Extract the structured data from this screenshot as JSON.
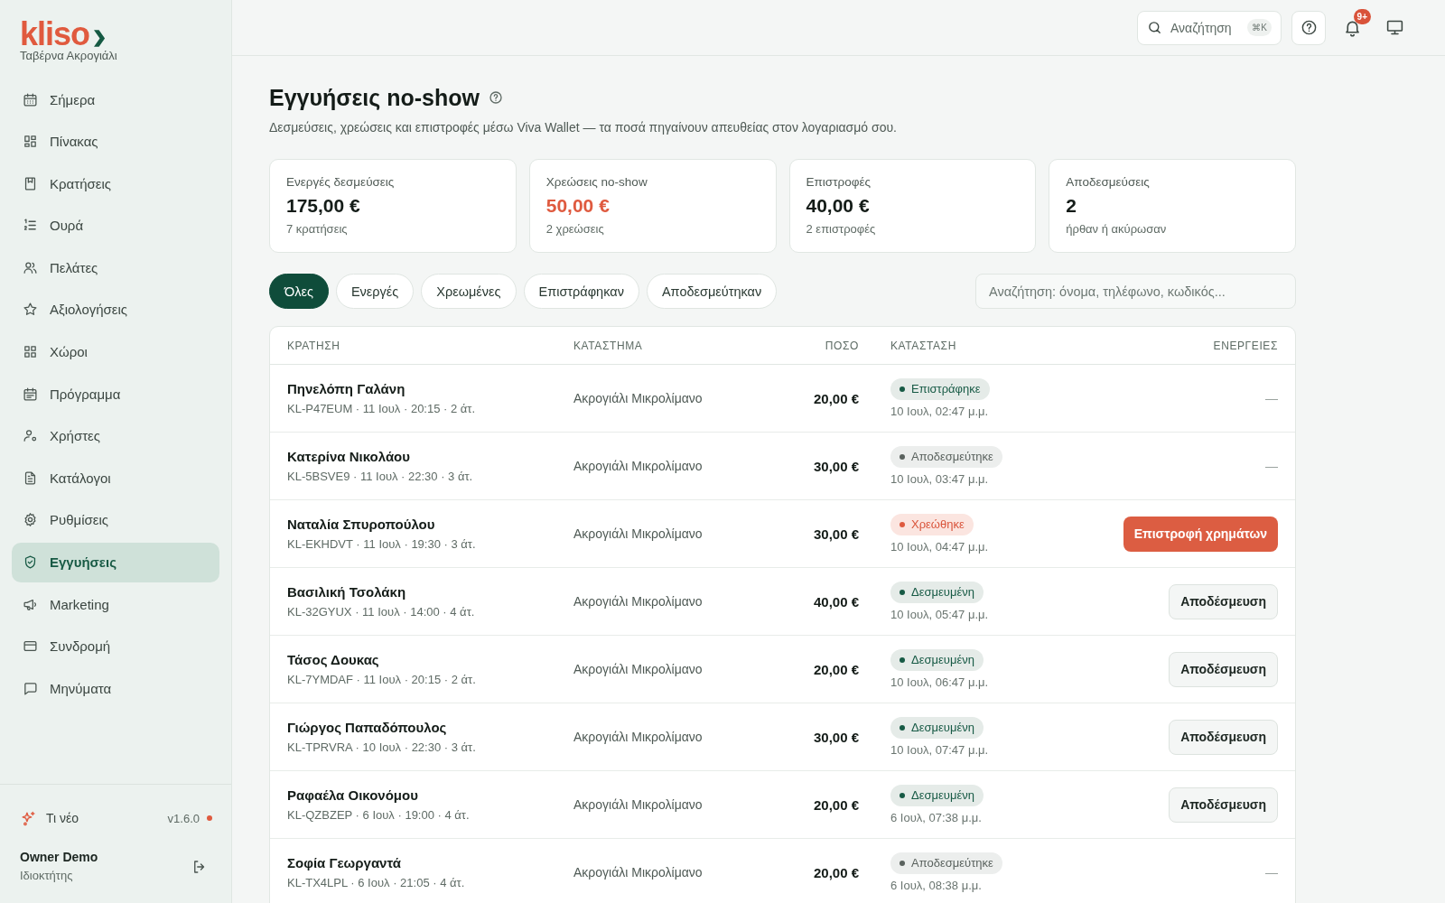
{
  "sidebar": {
    "brand": {
      "logo": "kliso",
      "venue": "Ταβέρνα Ακρογιάλι"
    },
    "items": [
      {
        "label": "Σήμερα",
        "selected": false
      },
      {
        "label": "Πίνακας",
        "selected": false
      },
      {
        "label": "Κρατήσεις",
        "selected": false
      },
      {
        "label": "Ουρά",
        "selected": false
      },
      {
        "label": "Πελάτες",
        "selected": false
      },
      {
        "label": "Αξιολογήσεις",
        "selected": false
      },
      {
        "label": "Χώροι",
        "selected": false
      },
      {
        "label": "Πρόγραμμα",
        "selected": false
      },
      {
        "label": "Χρήστες",
        "selected": false
      },
      {
        "label": "Κατάλογοι",
        "selected": false
      },
      {
        "label": "Ρυθμίσεις",
        "selected": false
      },
      {
        "label": "Εγγυήσεις",
        "selected": true
      },
      {
        "label": "Marketing",
        "selected": false
      },
      {
        "label": "Συνδρομή",
        "selected": false
      },
      {
        "label": "Μηνύματα",
        "selected": false
      }
    ],
    "whats_new": {
      "label": "Τι νέο",
      "version": "v1.6.0",
      "unread": true
    },
    "user": {
      "name": "Owner Demo",
      "role": "Ιδιοκτήτης"
    }
  },
  "topbar": {
    "search": {
      "label": "Αναζήτηση",
      "shortcut": "⌘K"
    },
    "notifications": {
      "badge": "9+"
    }
  },
  "page": {
    "title": "Εγγυήσεις no-show",
    "subtitle": "Δεσμεύσεις, χρεώσεις και επιστροφές μέσω Viva Wallet — τα ποσά πηγαίνουν απευθείας στον λογαριασμό σου."
  },
  "stats": [
    {
      "label": "Ενεργές δεσμεύσεις",
      "value": "175,00 €",
      "note": "7 κρατήσεις",
      "alert": false
    },
    {
      "label": "Χρεώσεις no-show",
      "value": "50,00 €",
      "note": "2 χρεώσεις",
      "alert": true
    },
    {
      "label": "Επιστροφές",
      "value": "40,00 €",
      "note": "2 επιστροφές",
      "alert": false
    },
    {
      "label": "Αποδεσμεύσεις",
      "value": "2",
      "note": "ήρθαν ή ακύρωσαν",
      "alert": false
    }
  ],
  "filters": [
    {
      "label": "Όλες",
      "selected": true
    },
    {
      "label": "Ενεργές",
      "selected": false
    },
    {
      "label": "Χρεωμένες",
      "selected": false
    },
    {
      "label": "Επιστράφηκαν",
      "selected": false
    },
    {
      "label": "Αποδεσμεύτηκαν",
      "selected": false
    }
  ],
  "search": {
    "placeholder": "Αναζήτηση: όνομα, τηλέφωνο, κωδικός..."
  },
  "table": {
    "columns": [
      "ΚΡΑΤΗΣΗ",
      "ΚΑΤΑΣΤΗΜΑ",
      "ΠΟΣΟ",
      "ΚΑΤΑΣΤΑΣΗ",
      "ΕΝΕΡΓΕΙΕΣ"
    ],
    "rows": [
      {
        "name": "Πηνελόπη Γαλάνη",
        "details": "KL-P47EUM · 11 Ιουλ · 20:15 · 2 άτ.",
        "store": "Ακρογιάλι Μικρολίμανο",
        "amount": "20,00 €",
        "status": {
          "kind": "refunded",
          "label": "Επιστράφηκε"
        },
        "time": "10 Ιουλ, 02:47 μ.μ.",
        "action": {
          "kind": "none",
          "label": "—"
        }
      },
      {
        "name": "Κατερίνα Νικολάου",
        "details": "KL-5BSVE9 · 11 Ιουλ · 22:30 · 3 άτ.",
        "store": "Ακρογιάλι Μικρολίμανο",
        "amount": "30,00 €",
        "status": {
          "kind": "released",
          "label": "Αποδεσμεύτηκε"
        },
        "time": "10 Ιουλ, 03:47 μ.μ.",
        "action": {
          "kind": "none",
          "label": "—"
        }
      },
      {
        "name": "Ναταλία Σπυροπούλου",
        "details": "KL-EKHDVT · 11 Ιουλ · 19:30 · 3 άτ.",
        "store": "Ακρογιάλι Μικρολίμανο",
        "amount": "30,00 €",
        "status": {
          "kind": "charged",
          "label": "Χρεώθηκε"
        },
        "time": "10 Ιουλ, 04:47 μ.μ.",
        "action": {
          "kind": "refund",
          "label": "Επιστροφή χρημάτων"
        }
      },
      {
        "name": "Βασιλική Τσολάκη",
        "details": "KL-32GYUX · 11 Ιουλ · 14:00 · 4 άτ.",
        "store": "Ακρογιάλι Μικρολίμανο",
        "amount": "40,00 €",
        "status": {
          "kind": "held",
          "label": "Δεσμευμένη"
        },
        "time": "10 Ιουλ, 05:47 μ.μ.",
        "action": {
          "kind": "release",
          "label": "Αποδέσμευση"
        }
      },
      {
        "name": "Τάσος Δουκας",
        "details": "KL-7YMDAF · 11 Ιουλ · 20:15 · 2 άτ.",
        "store": "Ακρογιάλι Μικρολίμανο",
        "amount": "20,00 €",
        "status": {
          "kind": "held",
          "label": "Δεσμευμένη"
        },
        "time": "10 Ιουλ, 06:47 μ.μ.",
        "action": {
          "kind": "release",
          "label": "Αποδέσμευση"
        }
      },
      {
        "name": "Γιώργος Παπαδόπουλος",
        "details": "KL-TPRVRA · 10 Ιουλ · 22:30 · 3 άτ.",
        "store": "Ακρογιάλι Μικρολίμανο",
        "amount": "30,00 €",
        "status": {
          "kind": "held",
          "label": "Δεσμευμένη"
        },
        "time": "10 Ιουλ, 07:47 μ.μ.",
        "action": {
          "kind": "release",
          "label": "Αποδέσμευση"
        }
      },
      {
        "name": "Ραφαέλα Οικονόμου",
        "details": "KL-QZBZEP · 6 Ιουλ · 19:00 · 4 άτ.",
        "store": "Ακρογιάλι Μικρολίμανο",
        "amount": "20,00 €",
        "status": {
          "kind": "held",
          "label": "Δεσμευμένη"
        },
        "time": "6 Ιουλ, 07:38 μ.μ.",
        "action": {
          "kind": "release",
          "label": "Αποδέσμευση"
        }
      },
      {
        "name": "Σοφία Γεωργαντά",
        "details": "KL-TX4LPL · 6 Ιουλ · 21:05 · 4 άτ.",
        "store": "Ακρογιάλι Μικρολίμανο",
        "amount": "20,00 €",
        "status": {
          "kind": "released",
          "label": "Αποδεσμεύτηκε"
        },
        "time": "6 Ιουλ, 08:38 μ.μ.",
        "action": {
          "kind": "none",
          "label": "—"
        }
      }
    ]
  }
}
